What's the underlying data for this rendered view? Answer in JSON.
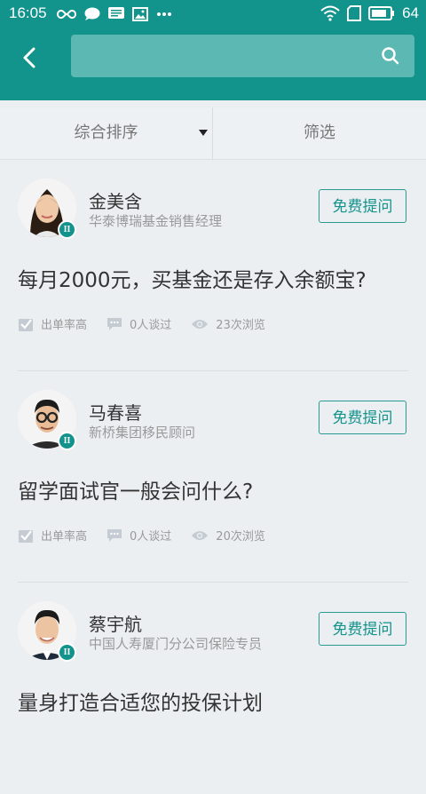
{
  "status": {
    "time": "16:05",
    "battery": "64"
  },
  "sort": {
    "default_label": "综合排序",
    "filter_label": "筛选"
  },
  "search": {
    "placeholder": ""
  },
  "cards": [
    {
      "name": "金美含",
      "title": "华泰博瑞基金销售经理",
      "ask_label": "免费提问",
      "question": "每月2000元，买基金还是存入余额宝?",
      "rate_label": "出单率高",
      "talks": "0人谈过",
      "views": "23次浏览",
      "badge": "II"
    },
    {
      "name": "马春喜",
      "title": "新桥集团移民顾问",
      "ask_label": "免费提问",
      "question": "留学面试官一般会问什么?",
      "rate_label": "出单率高",
      "talks": "0人谈过",
      "views": "20次浏览",
      "badge": "II"
    },
    {
      "name": "蔡宇航",
      "title": "中国人寿厦门分公司保险专员",
      "ask_label": "免费提问",
      "question": "量身打造合适您的投保计划",
      "rate_label": "",
      "talks": "",
      "views": "",
      "badge": "II"
    }
  ],
  "colors": {
    "primary": "#12938c",
    "search_bg": "#5cb8b2",
    "background": "#eceff2"
  }
}
